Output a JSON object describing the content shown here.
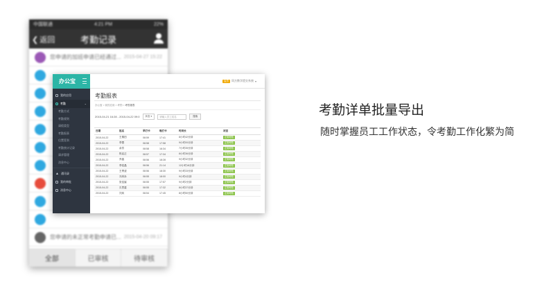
{
  "phone": {
    "status": {
      "carrier": "中国联通",
      "time": "4:21 PM",
      "battery": "22%"
    },
    "header": {
      "back_label": "返回",
      "title": "考勤记录"
    },
    "items": [
      {
        "text": "您申请的加班申请已经通过...",
        "time": "2015-04-27 15:22",
        "avatar_color": "#9b59b6"
      },
      {
        "text": "",
        "time": "",
        "avatar_color": "#2fa8e0"
      },
      {
        "text": "",
        "time": "",
        "avatar_color": "#2fa8e0"
      },
      {
        "text": "",
        "time": "",
        "avatar_color": "#2fa8e0"
      },
      {
        "text": "",
        "time": "",
        "avatar_color": "#2fa8e0"
      },
      {
        "text": "",
        "time": "",
        "avatar_color": "#2fa8e0"
      },
      {
        "text": "",
        "time": "",
        "avatar_color": "#2fa8e0"
      },
      {
        "text": "",
        "time": "",
        "avatar_color": "#e74c3c"
      },
      {
        "text": "",
        "time": "",
        "avatar_color": "#2fa8e0"
      },
      {
        "text": "",
        "time": "",
        "avatar_color": "#2fa8e0"
      },
      {
        "text": "您申请的未正常考勤申请已...",
        "time": "2015-04-20 09:17",
        "avatar_color": "#666666"
      }
    ],
    "tabs": [
      {
        "label": "全部",
        "active": true
      },
      {
        "label": "已审核",
        "active": false
      },
      {
        "label": "待审核",
        "active": false
      }
    ]
  },
  "desktop": {
    "logo": "办公宝",
    "user": {
      "badge": "会员",
      "name": "同方数字提交系统"
    },
    "sidebar": {
      "groups": [
        {
          "label": "我的应用",
          "type": "group"
        },
        {
          "label": "考勤",
          "type": "group-active"
        }
      ],
      "sub_items": [
        "考勤方式",
        "考勤规则",
        "请假类型",
        "考勤报表",
        "位置签到",
        "考勤统计记录",
        "请求管理",
        "消息中心"
      ],
      "bottom_items": [
        "通讯录",
        "我的审批",
        "消息中心"
      ]
    },
    "main": {
      "title": "考勤报表",
      "breadcrumb": [
        "办公宝",
        "我的应用",
        "考勤",
        "考勤报表"
      ],
      "filter": {
        "date_range": "2015-04-21 16:28 - 2015-04-22 09:0",
        "status_select": "状态",
        "name_placeholder": "请输入员工姓名",
        "search_button": "搜索"
      },
      "table": {
        "headers": [
          "日期",
          "姓名",
          "早打卡",
          "晚打卡",
          "时间长",
          "",
          "状态"
        ],
        "rows": [
          [
            "2015-04-22",
            "王素田",
            "08:59",
            "17:41",
            "8小时42分钟",
            "",
            "正常考勤"
          ],
          [
            "2015-04-22",
            "李蓉",
            "08:58",
            "17:58",
            "9小时00分钟",
            "",
            "正常考勤"
          ],
          [
            "2015-04-22",
            "余芳",
            "08:58",
            "16:34",
            "7小时35分钟",
            "",
            "正常考勤"
          ],
          [
            "2015-04-22",
            "陈启正",
            "08:57",
            "17:34",
            "8小时36分钟",
            "",
            "正常考勤"
          ],
          [
            "2015-04-22",
            "乔鑫",
            "08:56",
            "18:28",
            "9小时32分钟",
            "",
            "正常考勤"
          ],
          [
            "2015-04-22",
            "李若晶",
            "08:56",
            "21:14",
            "12小时18分钟",
            "",
            "正常考勤"
          ],
          [
            "2015-04-22",
            "王青波",
            "08:56",
            "18:30",
            "9小时33分钟",
            "",
            "正常考勤"
          ],
          [
            "2015-04-22",
            "冯林永",
            "08:55",
            "18:00",
            "9小时4分钟",
            "",
            "正常考勤"
          ],
          [
            "2015-04-22",
            "张佳宸",
            "08:55",
            "17:57",
            "9小时2分钟",
            "",
            "正常考勤"
          ],
          [
            "2015-04-22",
            "贝思重",
            "08:55",
            "17:32",
            "8小时37分钟",
            "",
            "正常考勤"
          ],
          [
            "2015-04-22",
            "刘凤",
            "08:54",
            "17:45",
            "8小时50分钟",
            "",
            "正常考勤"
          ]
        ]
      }
    }
  },
  "feature": {
    "heading": "考勤详单批量导出",
    "subtext": "随时掌握员工工作状态，令考勤工作化繁为简"
  }
}
